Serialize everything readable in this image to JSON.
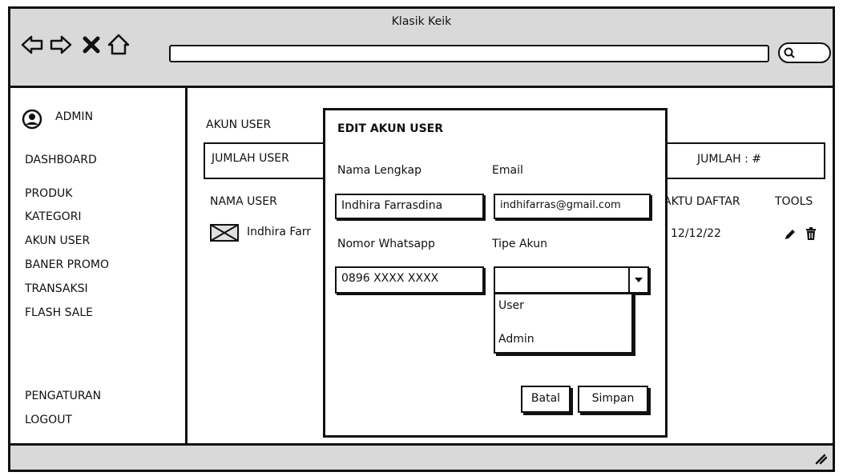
{
  "window": {
    "title": "Klasik Keik"
  },
  "sidebar": {
    "user_label": "ADMIN",
    "items": [
      "DASHBOARD",
      "PRODUK",
      "KATEGORI",
      "AKUN USER",
      "BANER PROMO",
      "TRANSAKSI",
      "FLASH SALE"
    ],
    "bottom_items": [
      "PENGATURAN",
      "LOGOUT"
    ]
  },
  "main": {
    "section_title": "AKUN USER",
    "jumlah_user_label": "JUMLAH USER",
    "jumlah_label": "JUMLAH : #",
    "table": {
      "headers": {
        "name": "NAMA USER",
        "date": "AKTU DAFTAR",
        "tools": "TOOLS"
      },
      "rows": [
        {
          "name": "Indhira Farr",
          "date": "12/12/22"
        }
      ]
    }
  },
  "modal": {
    "title": "EDIT AKUN USER",
    "fields": {
      "nama_label": "Nama Lengkap",
      "nama_value": "Indhira Farrasdina",
      "email_label": "Email",
      "email_value": "indhifarras@gmail.com",
      "wa_label": "Nomor Whatsapp",
      "wa_value": "0896 XXXX XXXX",
      "tipe_label": "Tipe Akun",
      "tipe_value": "",
      "tipe_options": [
        "User",
        "Admin"
      ]
    },
    "buttons": {
      "cancel": "Batal",
      "save": "Simpan"
    }
  }
}
